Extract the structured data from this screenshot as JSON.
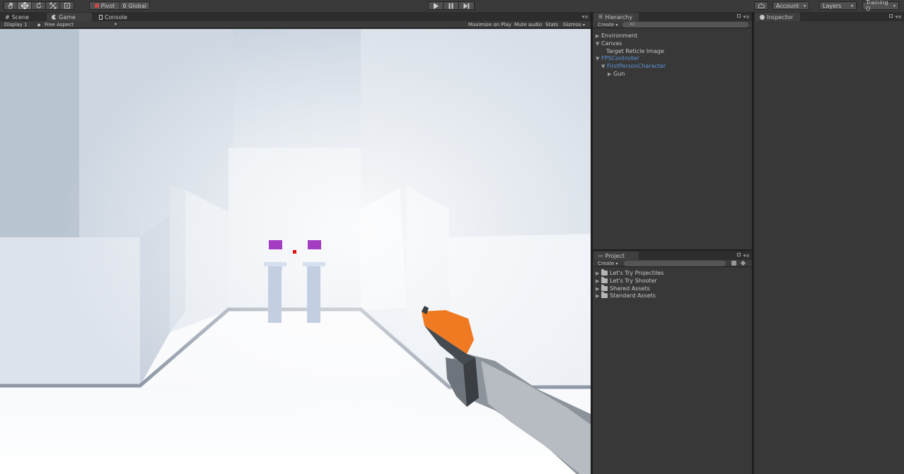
{
  "toolbar": {
    "pivot_label": "Pivot",
    "global_label": "Global",
    "account_label": "Account",
    "layers_label": "Layers",
    "layout_label": "Training O"
  },
  "game_panel": {
    "tabs": [
      {
        "label": "Scene"
      },
      {
        "label": "Game"
      },
      {
        "label": "Console"
      }
    ],
    "display_label": "Display 1",
    "aspect_label": "Free Aspect",
    "maximize_label": "Maximize on Play",
    "mute_label": "Mute audio",
    "stats_label": "Stats",
    "gizmos_label": "Gizmos"
  },
  "hierarchy": {
    "tab_label": "Hierarchy",
    "create_label": "Create",
    "search_placeholder": "All",
    "items": [
      {
        "label": "Environment"
      },
      {
        "label": "Canvas"
      },
      {
        "label": "Target Reticle Image"
      },
      {
        "label": "FPSController"
      },
      {
        "label": "FirstPersonCharacter"
      },
      {
        "label": "Gun"
      }
    ]
  },
  "project": {
    "tab_label": "Project",
    "create_label": "Create",
    "folders": [
      {
        "label": "Let's Try Projectiles"
      },
      {
        "label": "Let's Try Shooter"
      },
      {
        "label": "Shared Assets"
      },
      {
        "label": "Standard Assets"
      }
    ]
  },
  "inspector": {
    "tab_label": "Inspector"
  },
  "colors": {
    "accent_blue": "#5d95d8",
    "target_purple": "#a53cc4",
    "reticle_red": "#e01010",
    "gun_orange": "#f07a22"
  }
}
